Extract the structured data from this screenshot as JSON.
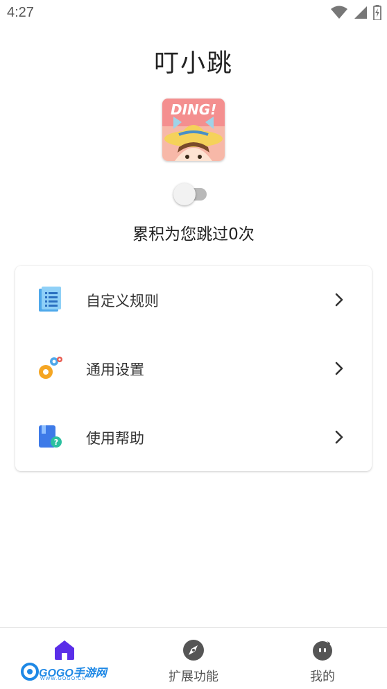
{
  "status_bar": {
    "time": "4:27",
    "icons": [
      "wifi-icon",
      "signal-icon",
      "battery-charging-icon"
    ]
  },
  "app": {
    "title": "叮小跳",
    "logo_text": "DING!",
    "toggle_on": false,
    "skip_summary": "累积为您跳过0次"
  },
  "menu": {
    "items": [
      {
        "label": "自定义规则",
        "icon": "document-list-icon"
      },
      {
        "label": "通用设置",
        "icon": "gears-icon"
      },
      {
        "label": "使用帮助",
        "icon": "help-book-icon"
      }
    ]
  },
  "bottom_nav": {
    "items": [
      {
        "label": "",
        "icon": "home-icon",
        "active": true
      },
      {
        "label": "扩展功能",
        "icon": "compass-icon",
        "active": false
      },
      {
        "label": "我的",
        "icon": "face-icon",
        "active": false
      }
    ]
  },
  "watermark": {
    "text": "GOGO手游网",
    "subtext": "WWW.GOGO.CN"
  },
  "colors": {
    "accent": "#5a2ee8",
    "nav_inactive": "#555555",
    "toggle_off_track": "#b9b9b9"
  }
}
